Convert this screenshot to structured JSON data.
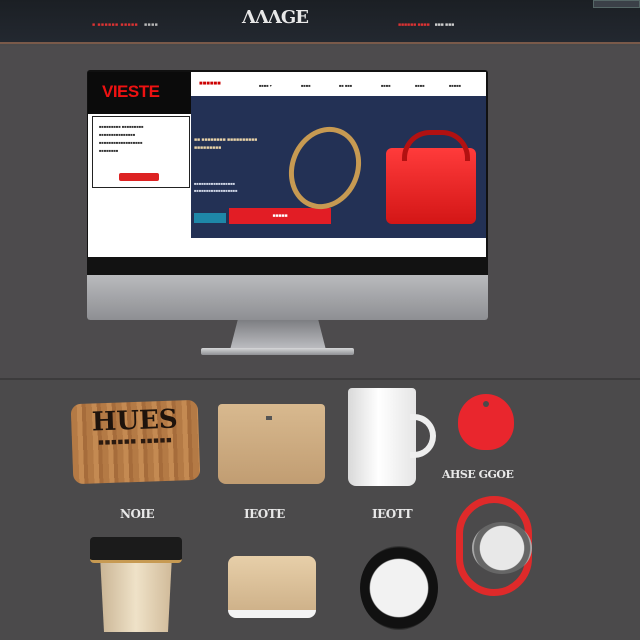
{
  "header": {
    "left_text": "■ ■■■■■■ ■■■■■",
    "left_muted": "■■■■",
    "brand": "ΛΛΛGE",
    "right_text": "■■■■■■ ■■■■",
    "right_muted": "■■■ ■■■"
  },
  "website": {
    "logo": "VIESTE",
    "nav_brand": "■■■■■■",
    "nav_items": [
      "■■■■ ▾",
      "■■■■",
      "■■ ■■■",
      "■■■■",
      "■■■■",
      "■■■■■"
    ],
    "popup_lines": [
      "■■■■■■■■■ ■■■■■■■■■",
      "■■■■■■■■■■■■■■■",
      "■■■■■■■■■■■■■■■■■■",
      "■■■■■■■■"
    ],
    "hero_text": "■■ ■■■■■■■■ ■■■■■■■■■■ ■■■■■■■■■",
    "hero_sub": "■■■■■■■■■■■■■■■■■ ■■■■■■■■■■■■■■■■■■",
    "cta": "■■■■■"
  },
  "products": {
    "wood_title": "HUES",
    "wood_sub": "■■■■■■ ■■■■■",
    "labels": [
      "AHSE GGOE",
      "NOIE",
      "IEOTE",
      "IEOTT"
    ]
  },
  "colors": {
    "accent": "#e21d25",
    "bg": "#4b4a4b",
    "navy": "#233155"
  },
  "icons": [
    "apple-logo-icon"
  ]
}
